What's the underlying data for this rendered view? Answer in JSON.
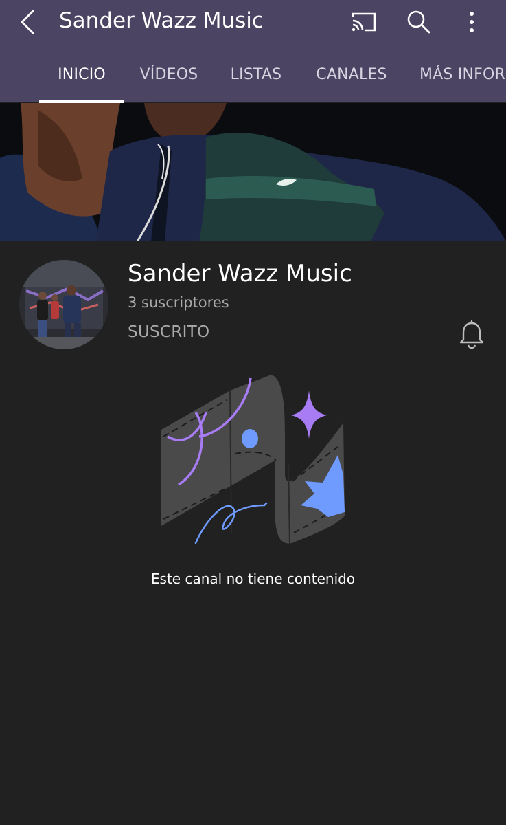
{
  "appbar": {
    "title": "Sander Wazz Music",
    "back_icon": "back-arrow-icon",
    "cast_icon": "cast-icon",
    "search_icon": "search-icon",
    "menu_icon": "more-vert-icon",
    "background": "#4b4462"
  },
  "tabs": [
    {
      "label": "INICIO",
      "active": true
    },
    {
      "label": "VÍDEOS",
      "active": false
    },
    {
      "label": "LISTAS",
      "active": false
    },
    {
      "label": "CANALES",
      "active": false
    },
    {
      "label": "MÁS INFORMACIÓN",
      "active": false
    }
  ],
  "channel": {
    "name": "Sander Wazz Music",
    "subscribers": "3 suscriptores",
    "subscribe_state": "SUSCRITO",
    "bell_icon": "bell-icon"
  },
  "empty_state": {
    "message": "Este canal no tiene contenido",
    "accent_colors": [
      "#a77cf5",
      "#6f9bff"
    ]
  }
}
